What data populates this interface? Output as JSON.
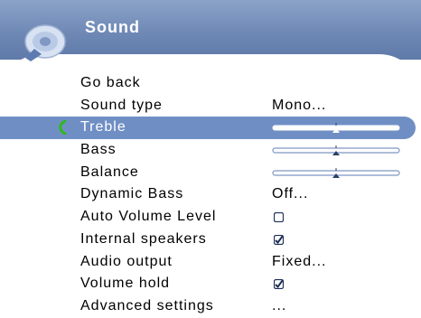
{
  "header": {
    "title": "Sound",
    "icon": "speaker-icon"
  },
  "colors": {
    "header": "#6f89b6",
    "selected_row": "#6f8fc4",
    "cursor": "#2fb81a"
  },
  "menu": {
    "items": [
      {
        "label": "Go back"
      },
      {
        "label": "Sound type",
        "value": "Mono..."
      },
      {
        "label": "Treble",
        "selected": true,
        "slider_level": 0.5
      },
      {
        "label": "Bass",
        "slider_level": 0.5
      },
      {
        "label": "Balance",
        "slider_level": 0.5
      },
      {
        "label": "Dynamic Bass",
        "value": "Off..."
      },
      {
        "label": "Auto Volume Level",
        "checked": false
      },
      {
        "label": "Internal speakers",
        "checked": true
      },
      {
        "label": "Audio output",
        "value": "Fixed..."
      },
      {
        "label": "Volume hold",
        "checked": true
      },
      {
        "label": "Advanced settings",
        "value": "..."
      }
    ]
  }
}
